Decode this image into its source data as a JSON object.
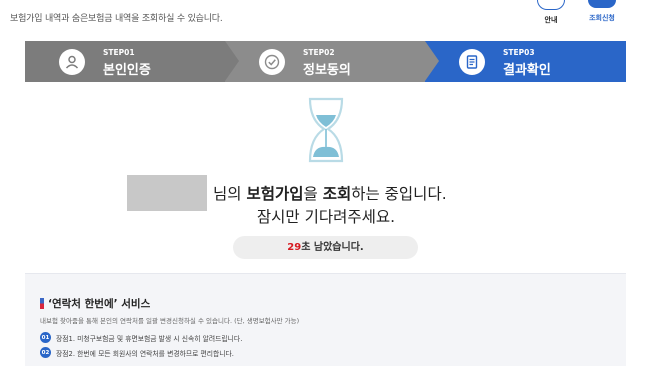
{
  "header": {
    "intro": "보험가입 내역과 숨은보험금 내역을 조회하실 수 있습니다.",
    "guide_label": "안내",
    "apply_label": "조회신청"
  },
  "steps": [
    {
      "number": "STEP01",
      "title": "본인인증",
      "icon": "user-icon"
    },
    {
      "number": "STEP02",
      "title": "정보동의",
      "icon": "check-icon"
    },
    {
      "number": "STEP03",
      "title": "결과확인",
      "icon": "document-icon"
    }
  ],
  "message": {
    "suffix_1": "님의 ",
    "bold_1": "보험가입",
    "part_2": "을 ",
    "bold_2": "조회",
    "part_3": "하는 중입니다.",
    "line2": "잠시만 기다려주세요."
  },
  "timer": {
    "seconds": "29",
    "label": "초 남았습니다."
  },
  "service": {
    "title": "‘연락처 한번에’ 서비스",
    "description": "내보험 찾아줌을 통해 본인의 연락처를 일괄 변경신청하실 수 있습니다. (단, 생명보험사만 가능)",
    "items": [
      {
        "badge": "01",
        "text": "장점1. 미청구보험금 및 휴면보험금 발생 시 신속히 알려드립니다."
      },
      {
        "badge": "02",
        "text": "장점2. 한번에 모든 회원사의 연락처를 변경하므로 편리합니다."
      }
    ]
  },
  "colors": {
    "accent": "#2a66c8",
    "step_gray": "#7c7c7c",
    "highlight_red": "#d71920"
  }
}
